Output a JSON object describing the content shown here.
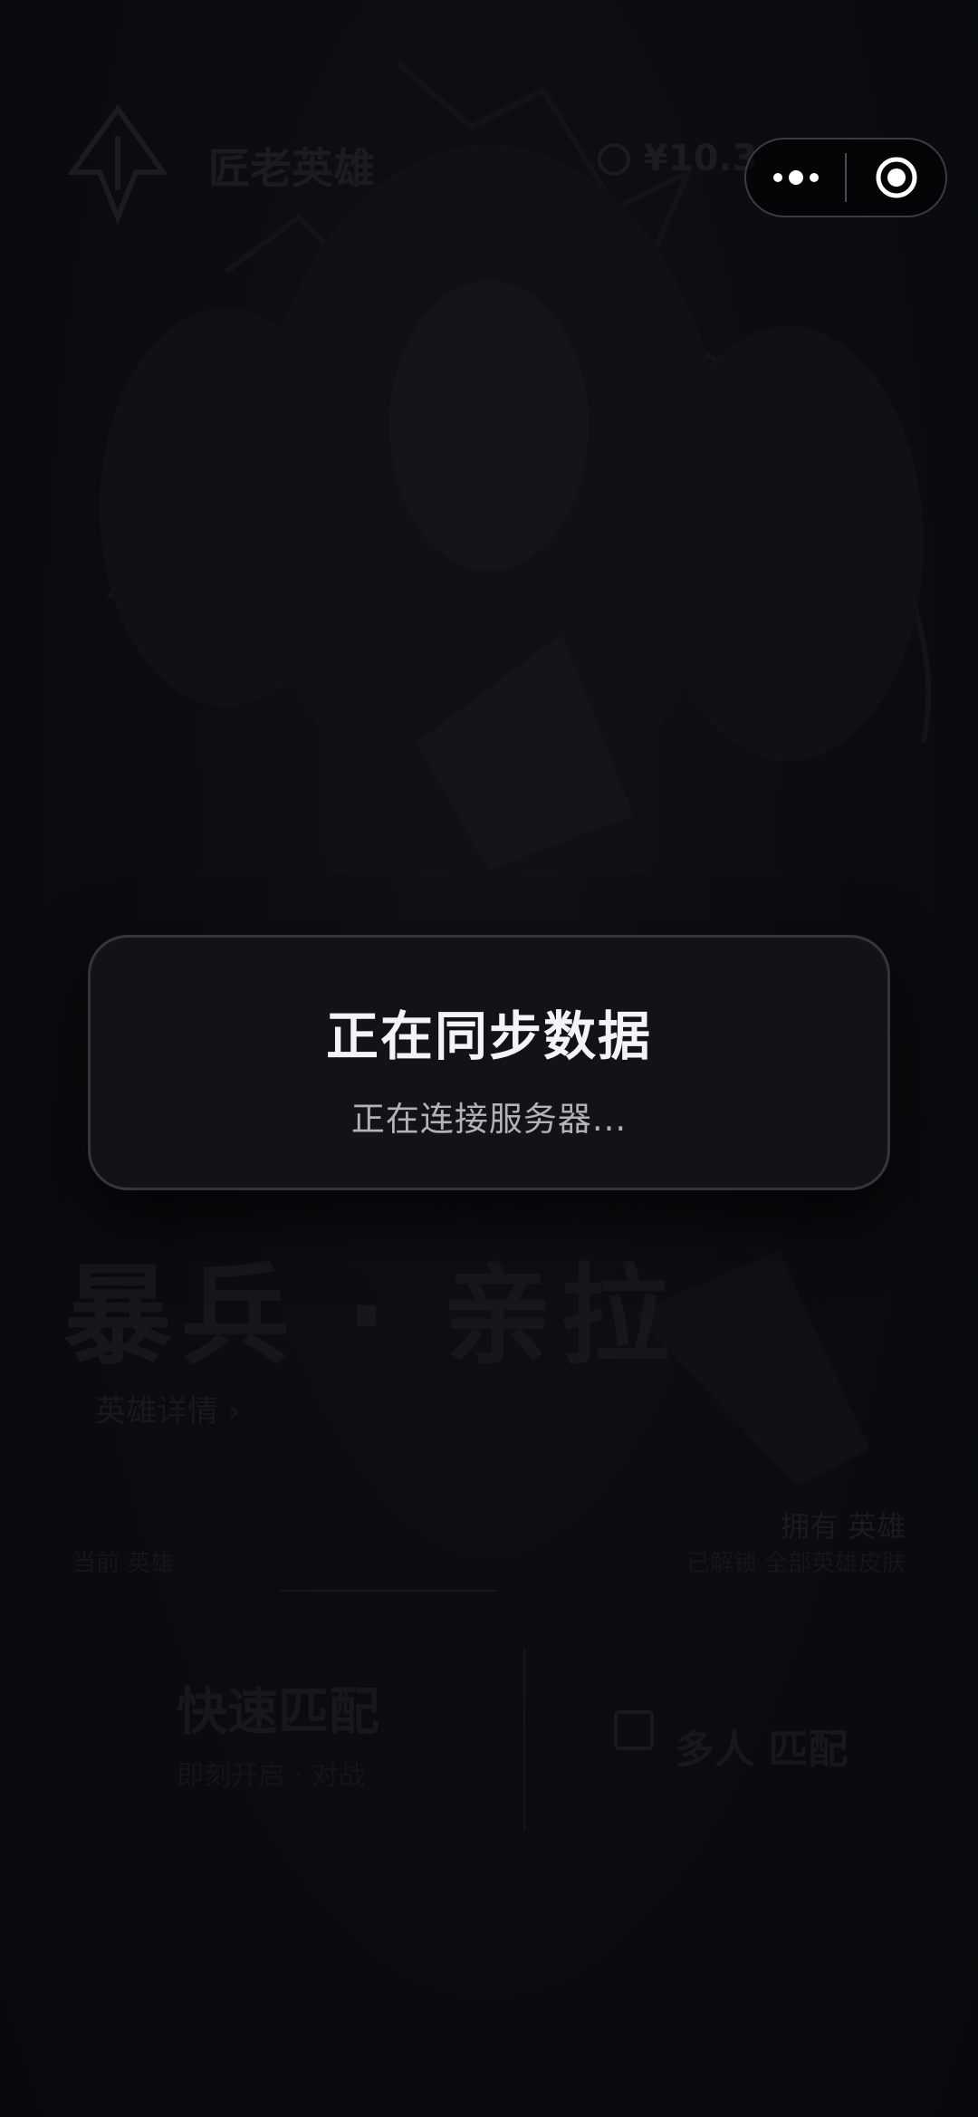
{
  "background": {
    "app_title": "匠老英雄",
    "currency_amount": "¥10.3",
    "hero_name": "暴兵 · 亲拉",
    "hero_detail_link": "英雄详情 ›",
    "hero_owner": "拥有 英雄",
    "hero_owner_sub": "已解锁 全部英雄皮肤",
    "left_caption": "当前 英雄",
    "quick_match_title": "快速匹配",
    "quick_match_sub": "即刻开启 · 对战",
    "multi_match_title": "多人 匹配"
  },
  "sync_modal": {
    "title": "正在同步数据",
    "message": "正在连接服务器..."
  },
  "capsule": {
    "more_icon": "more-dots-icon",
    "close_icon": "close-target-icon"
  },
  "colors": {
    "page_bg": "#0b0c10",
    "modal_bg": "#121318",
    "modal_border": "#34363c",
    "title_text": "#f4f4f6",
    "message_text": "#b2b3b8"
  }
}
